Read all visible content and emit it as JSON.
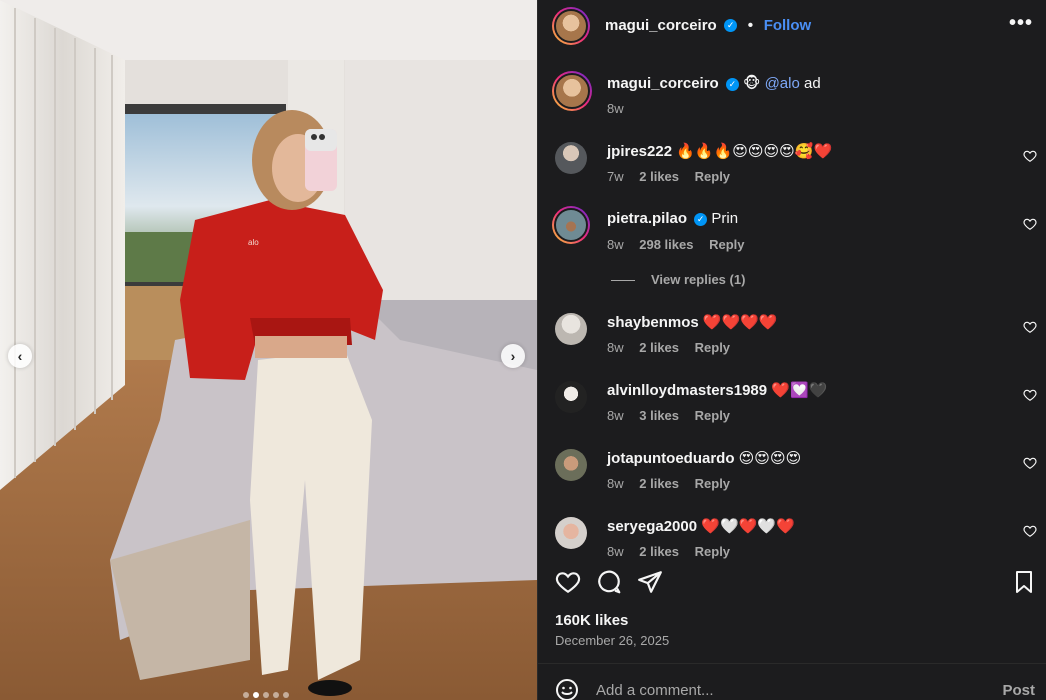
{
  "post": {
    "username": "magui_corceiro",
    "follow_label": "Follow",
    "more_label": "•••",
    "caption_emoji": "🐵",
    "caption_mention": "@alo",
    "caption_text": "ad",
    "caption_time": "8w"
  },
  "comments": [
    {
      "username": "jpires222",
      "text": "🔥🔥🔥😍😍😍😍🥰❤️",
      "time": "7w",
      "likes": "2 likes",
      "reply": "Reply",
      "verified": false
    },
    {
      "username": "pietra.pilao",
      "text": "Prin",
      "time": "8w",
      "likes": "298 likes",
      "reply": "Reply",
      "verified": true
    },
    {
      "username": "shaybenmos",
      "text": "❤️❤️❤️❤️",
      "time": "8w",
      "likes": "2 likes",
      "reply": "Reply",
      "verified": false
    },
    {
      "username": "alvinlloydmasters1989",
      "text": "❤️💟🖤",
      "time": "8w",
      "likes": "3 likes",
      "reply": "Reply",
      "verified": false
    },
    {
      "username": "jotapuntoeduardo",
      "text": "😍😍😍😍",
      "time": "8w",
      "likes": "2 likes",
      "reply": "Reply",
      "verified": false
    },
    {
      "username": "seryega2000",
      "text": "❤️🤍❤️🤍❤️",
      "time": "8w",
      "likes": "2 likes",
      "reply": "Reply",
      "verified": false
    }
  ],
  "view_replies": "View replies (1)",
  "likes_count": "160K likes",
  "date": "December 26, 2025",
  "comment_placeholder": "Add a comment...",
  "post_button": "Post",
  "carousel": {
    "slides": 5,
    "active_index": 1
  },
  "colors": {
    "panel_bg": "#1c1c1e",
    "link": "#4a8ff5",
    "verified": "#0095f6",
    "muted": "#a8a8a8"
  },
  "icons": [
    "heart-icon",
    "comment-icon",
    "share-icon",
    "bookmark-icon",
    "emoji-icon",
    "chevron-left-icon",
    "chevron-right-icon",
    "more-icon"
  ]
}
